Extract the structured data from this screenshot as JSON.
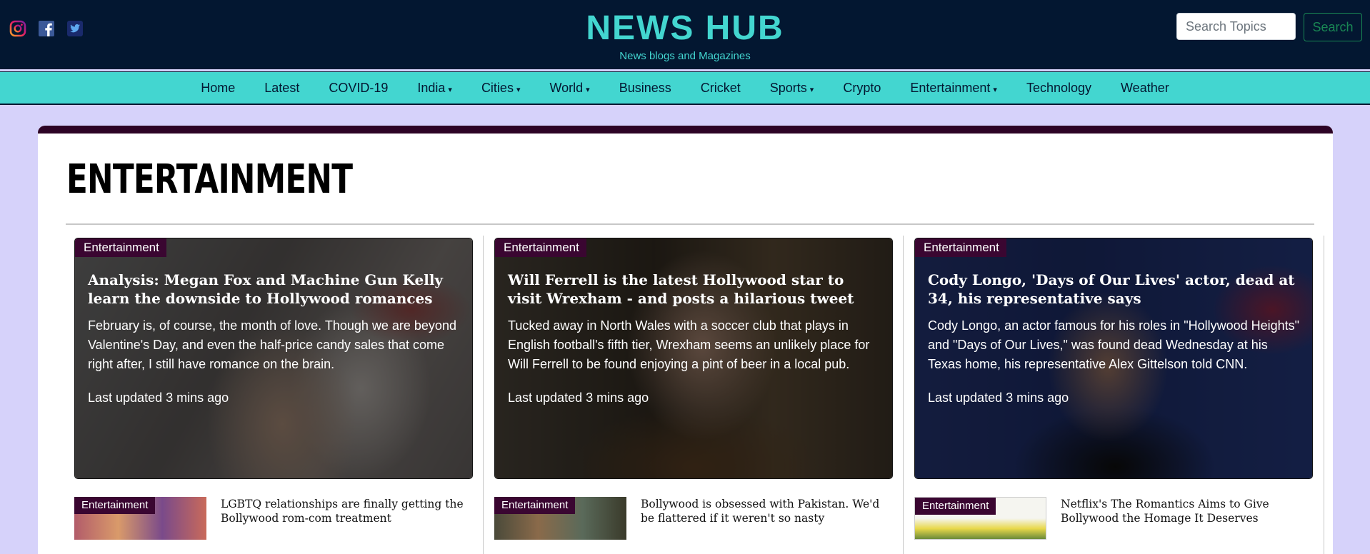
{
  "header": {
    "title": "NEWS HUB",
    "subtitle": "News blogs and Magazines",
    "search_placeholder": "Search Topics",
    "search_button": "Search",
    "social_icons": [
      "instagram-icon",
      "facebook-icon",
      "twitter-icon"
    ]
  },
  "nav": {
    "items": [
      {
        "label": "Home",
        "dropdown": false
      },
      {
        "label": "Latest",
        "dropdown": false
      },
      {
        "label": "COVID-19",
        "dropdown": false
      },
      {
        "label": "India",
        "dropdown": true
      },
      {
        "label": "Cities",
        "dropdown": true
      },
      {
        "label": "World",
        "dropdown": true
      },
      {
        "label": "Business",
        "dropdown": false
      },
      {
        "label": "Cricket",
        "dropdown": false
      },
      {
        "label": "Sports",
        "dropdown": true
      },
      {
        "label": "Crypto",
        "dropdown": false
      },
      {
        "label": "Entertainment",
        "dropdown": true
      },
      {
        "label": "Technology",
        "dropdown": false
      },
      {
        "label": "Weather",
        "dropdown": false
      }
    ],
    "caret": "▾"
  },
  "section": {
    "title": "ENTERTAINMENT"
  },
  "featured": [
    {
      "badge": "Entertainment",
      "title": "Analysis: Megan Fox and Machine Gun Kelly learn the downside to Hollywood romances",
      "description": "February is, of course, the month of love. Though we are beyond Valentine's Day, and even the half-price candy sales that come right after, I still have romance on the brain.",
      "meta": "Last updated 3 mins ago"
    },
    {
      "badge": "Entertainment",
      "title": "Will Ferrell is the latest Hollywood star to visit Wrexham - and posts a hilarious tweet",
      "description": "Tucked away in North Wales with a soccer club that plays in English football's fifth tier, Wrexham seems an unlikely place for Will Ferrell to be found enjoying a pint of beer in a local pub.",
      "meta": "Last updated 3 mins ago"
    },
    {
      "badge": "Entertainment",
      "title": "Cody Longo, 'Days of Our Lives' actor, dead at 34, his representative says",
      "description": "Cody Longo, an actor famous for his roles in \"Hollywood Heights\" and \"Days of Our Lives,\" was found dead Wednesday at his Texas home, his representative Alex Gittelson told CNN.",
      "meta": "Last updated 3 mins ago"
    }
  ],
  "list": [
    {
      "badge": "Entertainment",
      "title": "LGBTQ relationships are finally getting the Bollywood rom-com treatment"
    },
    {
      "badge": "Entertainment",
      "title": "Bollywood is obsessed with Pakistan. We'd be flattered if it weren't so nasty"
    },
    {
      "badge": "Entertainment",
      "title": "Netflix's The Romantics Aims to Give Bollywood the Homage It Deserves"
    }
  ],
  "colors": {
    "header_bg": "#031731",
    "accent": "#43d6d0",
    "page_bg": "#d6d2fa",
    "badge_bg": "#3a0631"
  }
}
